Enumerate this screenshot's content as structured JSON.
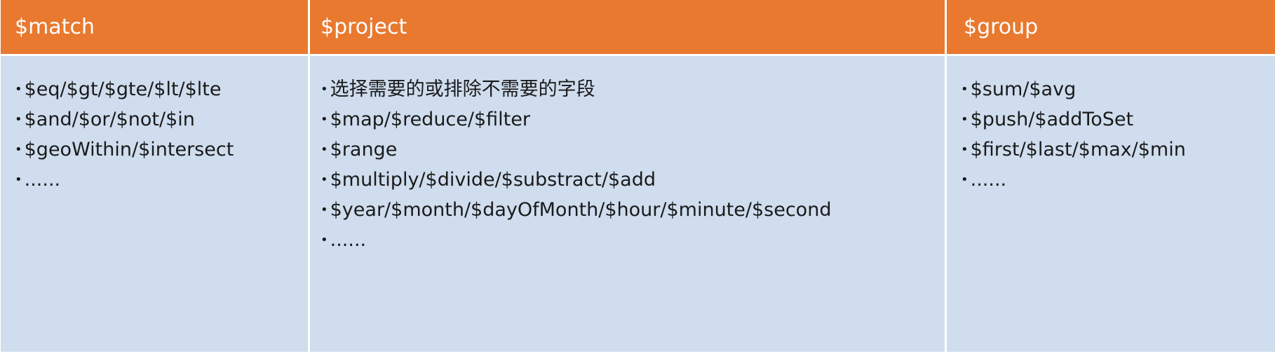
{
  "table": {
    "headers": [
      "$match",
      "$project",
      "$group"
    ],
    "columns": [
      {
        "items": [
          "$eq/$gt/$gte/$lt/$lte",
          "$and/$or/$not/$in",
          "$geoWithin/$intersect",
          "......"
        ]
      },
      {
        "items": [
          "选择需要的或排除不需要的字段",
          "$map/$reduce/$filter",
          "$range",
          "$multiply/$divide/$substract/$add",
          "$year/$month/$dayOfMonth/$hour/$minute/$second",
          "......"
        ]
      },
      {
        "items": [
          "$sum/$avg",
          "$push/$addToSet",
          "$first/$last/$max/$min",
          "......"
        ]
      }
    ]
  },
  "colors": {
    "header_bg": "#e8792f",
    "header_text": "#ffffff",
    "body_bg": "#cfddee",
    "body_text": "#1a1a1a"
  }
}
